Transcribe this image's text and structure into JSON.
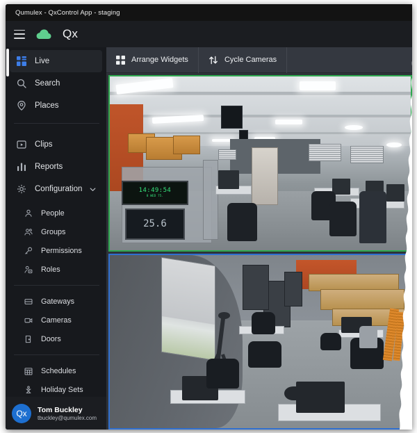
{
  "window": {
    "title": "Qumulex - QxControl App - staging"
  },
  "header": {
    "menu_icon": "hamburger-menu-icon",
    "cloud_icon": "cloud-icon",
    "brand": "Qx"
  },
  "sidebar": {
    "primary_items": [
      {
        "label": "Live",
        "icon": "dashboard-icon",
        "active": true
      },
      {
        "label": "Search",
        "icon": "search-icon",
        "active": false
      },
      {
        "label": "Places",
        "icon": "location-pin-icon",
        "active": false
      }
    ],
    "secondary_items": [
      {
        "label": "Clips",
        "icon": "clip-play-icon"
      },
      {
        "label": "Reports",
        "icon": "bar-chart-icon"
      },
      {
        "label": "Configuration",
        "icon": "gear-icon",
        "expanded": true,
        "chevron": "chevron-down-icon"
      }
    ],
    "config_group_1": [
      {
        "label": "People",
        "icon": "person-icon"
      },
      {
        "label": "Groups",
        "icon": "people-group-icon"
      },
      {
        "label": "Permissions",
        "icon": "key-icon"
      },
      {
        "label": "Roles",
        "icon": "role-badge-icon"
      }
    ],
    "config_group_2": [
      {
        "label": "Gateways",
        "icon": "gateway-icon"
      },
      {
        "label": "Cameras",
        "icon": "video-camera-icon"
      },
      {
        "label": "Doors",
        "icon": "door-icon"
      }
    ],
    "config_group_3": [
      {
        "label": "Schedules",
        "icon": "calendar-icon"
      },
      {
        "label": "Holiday Sets",
        "icon": "holiday-tree-icon"
      }
    ],
    "user": {
      "avatar_text": "Qx",
      "name": "Tom Buckley",
      "email": "tbuckley@qumulex.com"
    }
  },
  "toolbar": {
    "buttons": [
      {
        "label": "Arrange Widgets",
        "icon": "grid-squares-icon"
      },
      {
        "label": "Cycle Cameras",
        "icon": "swap-arrows-icon"
      }
    ]
  },
  "camera_grid": {
    "widgets": [
      {
        "name": "camera-widget-top",
        "selection": "green",
        "scene": "warehouse-office-wide"
      },
      {
        "name": "camera-widget-bottom",
        "selection": "blue",
        "scene": "fisheye-office-overhead"
      }
    ]
  },
  "scene1_overlays": {
    "clock_time": "14:49:54",
    "clock_sub": "8 WED 75.",
    "clock2_big": "25.6"
  },
  "colors": {
    "accent_blue": "#3d7ee8",
    "selection_green": "#2ea84f",
    "selection_blue": "#2f6fd0",
    "sidebar_bg": "#17191d",
    "titlebar_bg": "#131313",
    "toolbar_bg": "#343840",
    "cloud_green": "#5fcf8e",
    "avatar_blue": "#1d6fd0"
  }
}
